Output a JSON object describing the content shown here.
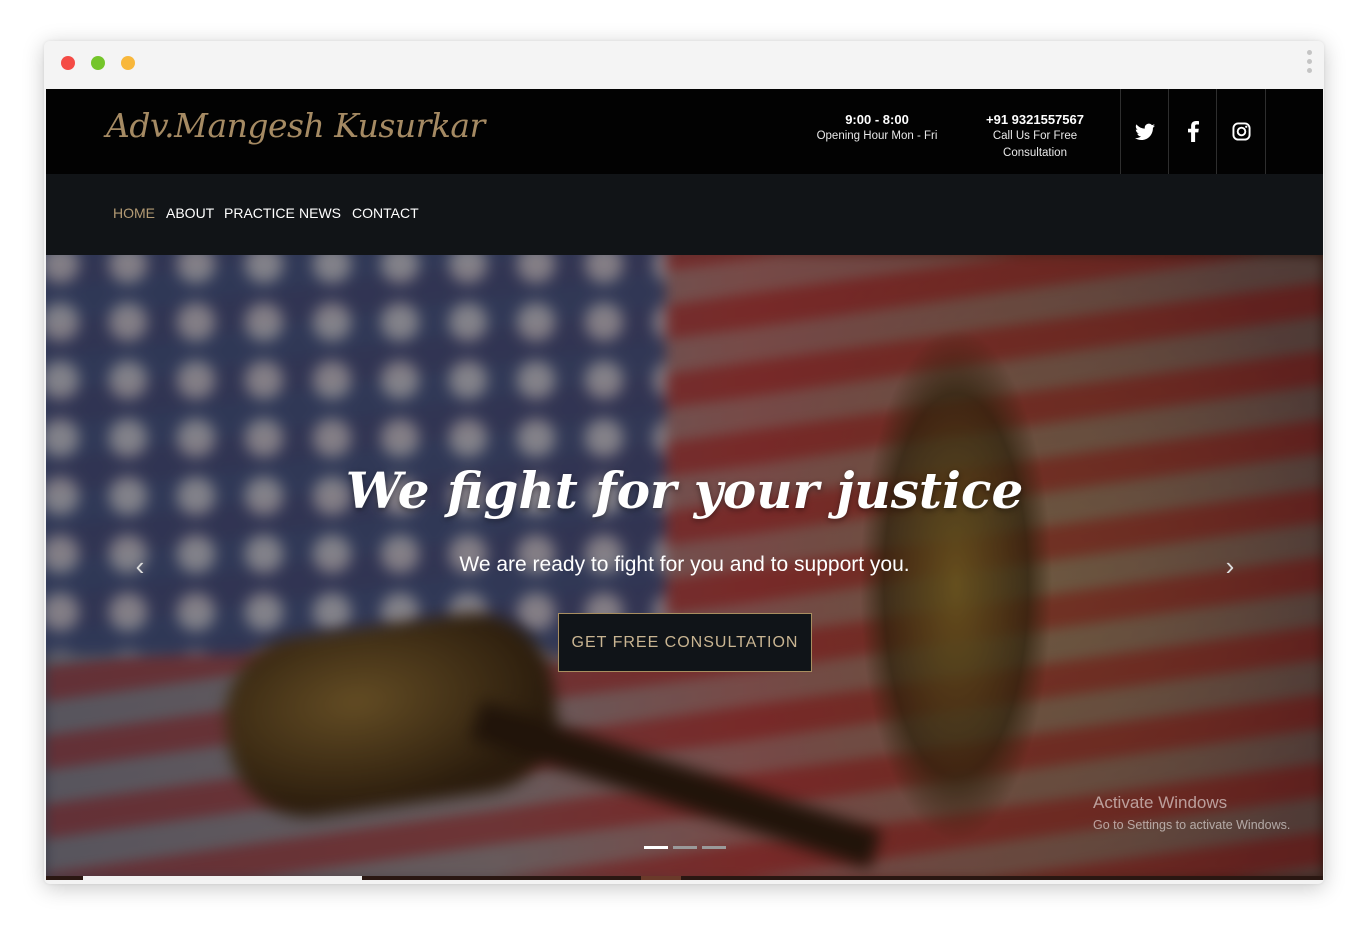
{
  "window": {
    "controls": [
      "close",
      "minimize",
      "maximize"
    ],
    "menu_icon": "kebab-menu-icon"
  },
  "header": {
    "logo": "Adv.Mangesh Kusurkar",
    "hours": {
      "main": "9:00 - 8:00",
      "caption": "Opening Hour Mon - Fri"
    },
    "phone": {
      "main": "+91 9321557567",
      "caption": "Call Us For Free Consultation"
    },
    "social": [
      {
        "name": "twitter",
        "icon": "twitter-icon"
      },
      {
        "name": "facebook",
        "icon": "facebook-icon"
      },
      {
        "name": "instagram",
        "icon": "instagram-icon"
      }
    ]
  },
  "nav": {
    "items": [
      {
        "label": "HOME",
        "active": true
      },
      {
        "label": "ABOUT",
        "active": false
      },
      {
        "label": "PRACTICE",
        "active": false
      },
      {
        "label": "NEWS",
        "active": false
      },
      {
        "label": "CONTACT",
        "active": false
      }
    ]
  },
  "hero": {
    "title": "We fight for your justice",
    "subtitle": "We are ready to fight for you and to support you.",
    "cta_label": "GET FREE CONSULTATION",
    "prev_glyph": "‹",
    "next_glyph": "›",
    "slide_count": 3,
    "active_slide": 1
  },
  "watermark": {
    "line1": "Activate Windows",
    "line2": "Go to Settings to activate Windows."
  },
  "colors": {
    "accent_gold": "#b49b74",
    "logo_gold": "#a58a63",
    "topbar_bg": "#020202",
    "nav_bg": "#111417"
  }
}
